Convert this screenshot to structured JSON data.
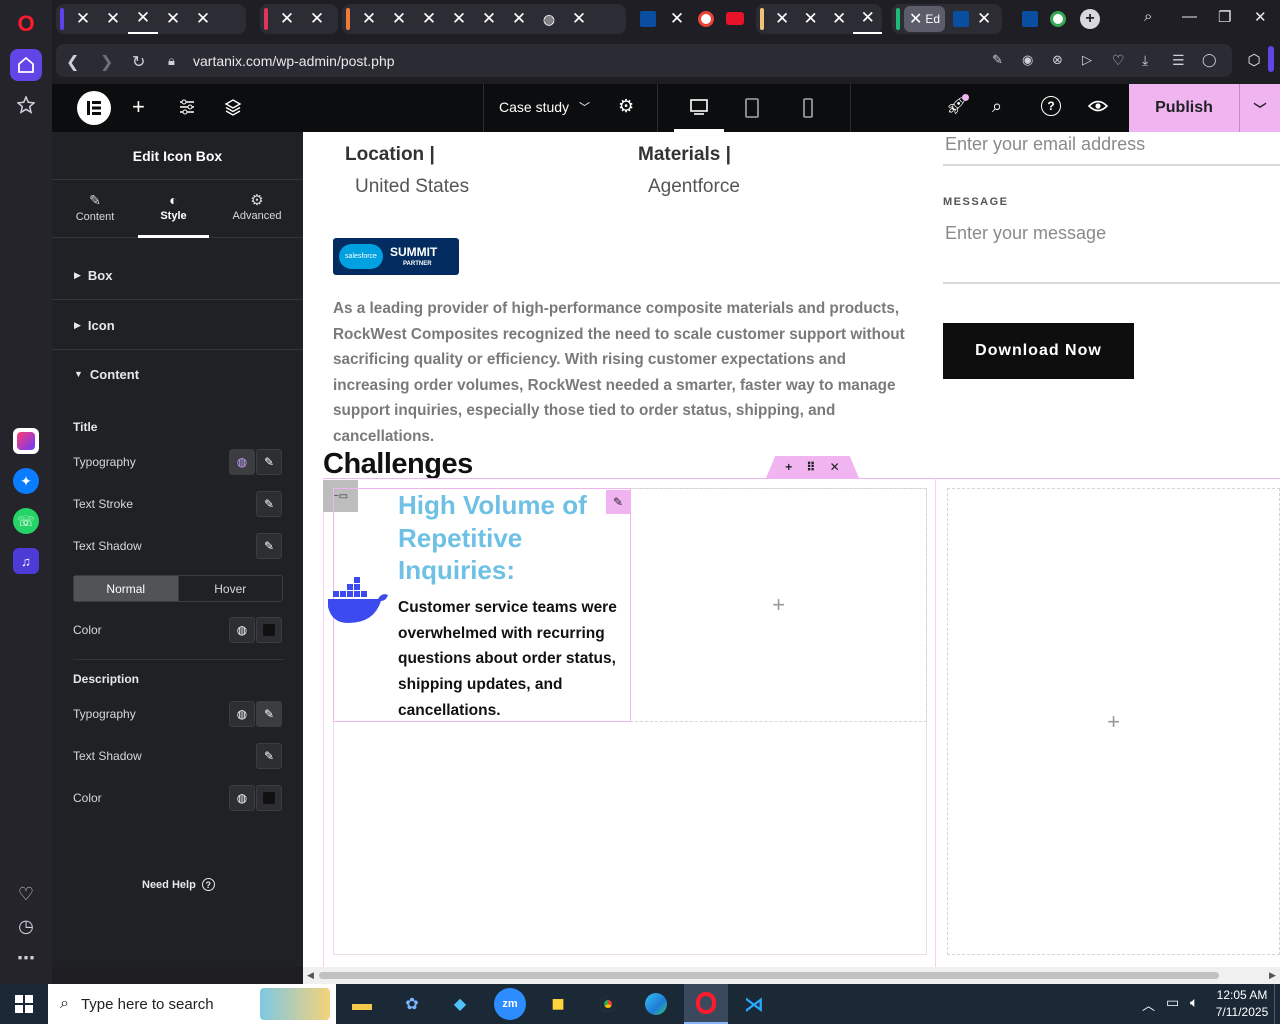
{
  "browser": {
    "url": "vartanix.com/wp-admin/post.php",
    "tab_active_label": "Ed"
  },
  "editor": {
    "template_name": "Case study",
    "publish_label": "Publish",
    "panel_title": "Edit Icon Box",
    "tabs": [
      {
        "label": "Content"
      },
      {
        "label": "Style"
      },
      {
        "label": "Advanced"
      }
    ],
    "sections": [
      {
        "label": "Box"
      },
      {
        "label": "Icon"
      },
      {
        "label": "Content"
      }
    ],
    "title_group": {
      "heading": "Title",
      "typography": "Typography",
      "text_stroke": "Text Stroke",
      "text_shadow": "Text Shadow",
      "normal": "Normal",
      "hover": "Hover",
      "color": "Color"
    },
    "description_group": {
      "heading": "Description",
      "typography": "Typography",
      "text_shadow": "Text Shadow",
      "color": "Color"
    },
    "need_help": "Need Help"
  },
  "page": {
    "location_label": "Location |",
    "location_value": "United States",
    "materials_label": "Materials |",
    "materials_value": "Agentforce",
    "badge_brand": "salesforce",
    "badge_title": "SUMMIT",
    "badge_sub": "PARTNER",
    "intro": "As a leading provider of high-performance composite materials and products, RockWest Composites recognized the need to scale customer support without sacrificing quality or efficiency. With rising customer expectations and increasing order volumes, RockWest needed a smarter, faster way to manage support inquiries, especially those tied to order status, shipping, and cancellations.",
    "email_placeholder": "Enter your email address",
    "message_label": "MESSAGE",
    "message_placeholder": "Enter your message",
    "download_label": "Download Now",
    "challenges_heading": "Challenges",
    "iconbox_title": "High Volume of Repetitive Inquiries:",
    "iconbox_desc": "Customer service teams were overwhelmed with recurring questions about order status, shipping updates, and cancellations."
  },
  "taskbar": {
    "search_placeholder": "Type here to search",
    "time": "12:05 AM",
    "date": "7/11/2025"
  },
  "colors": {
    "accent_pink": "#f0b4f0",
    "title_blue": "#6ec1e4",
    "docker_blue": "#3b4bf0",
    "badge_navy": "#032d60"
  }
}
